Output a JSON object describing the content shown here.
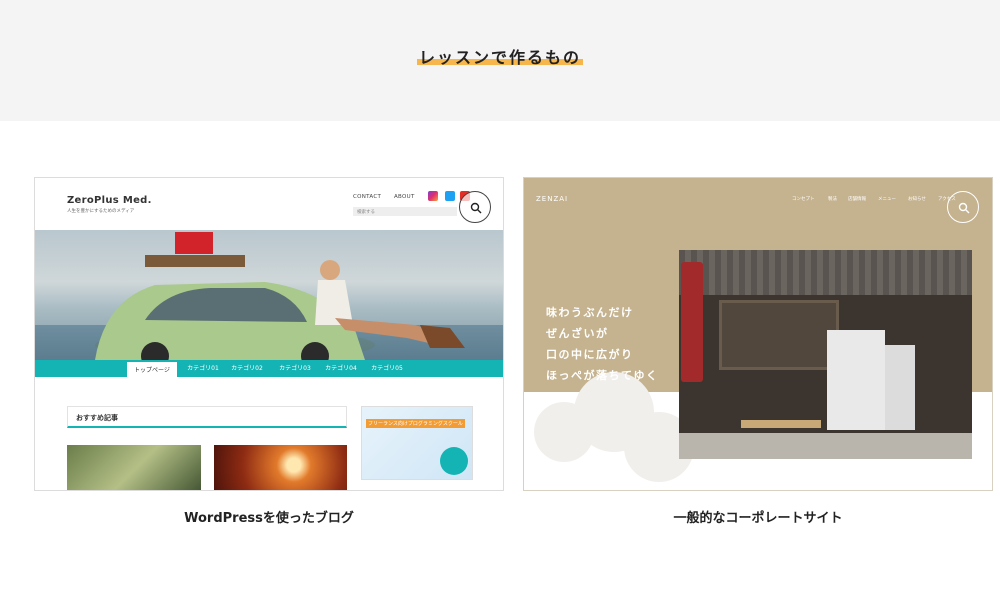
{
  "section": {
    "title": "レッスンで作るもの"
  },
  "cards": [
    {
      "caption": "WordPressを使ったブログ",
      "mock": {
        "site_name": "ZeroPlus Med.",
        "tagline": "人生を豊かにするためのメディア",
        "nav": [
          "CONTACT",
          "ABOUT"
        ],
        "search_placeholder": "検索する",
        "tabs": [
          "トップページ",
          "カテゴリ01",
          "カテゴリ02",
          "カテゴリ03",
          "カテゴリ04",
          "カテゴリ05"
        ],
        "active_tab": "トップページ",
        "recommended_title": "おすすめ記事",
        "ad_text": "フリーランス向けプログラミングスクール",
        "social_icons": [
          "instagram-icon",
          "twitter-icon",
          "youtube-icon"
        ]
      }
    },
    {
      "caption": "一般的なコーポレートサイト",
      "mock": {
        "site_name": "ZENZAI",
        "nav": [
          "コンセプト",
          "製法",
          "店舗情報",
          "メニュー",
          "お知らせ",
          "アクセス"
        ],
        "copy_lines": [
          "味わうぶんだけ",
          "ぜんざいが",
          "口の中に広がり",
          "ほっぺが落ちてゆく"
        ]
      }
    }
  ],
  "colors": {
    "accent_underline": "#f7b64b",
    "blog_teal": "#14b4b4",
    "corporate_beige": "#c5b390"
  }
}
